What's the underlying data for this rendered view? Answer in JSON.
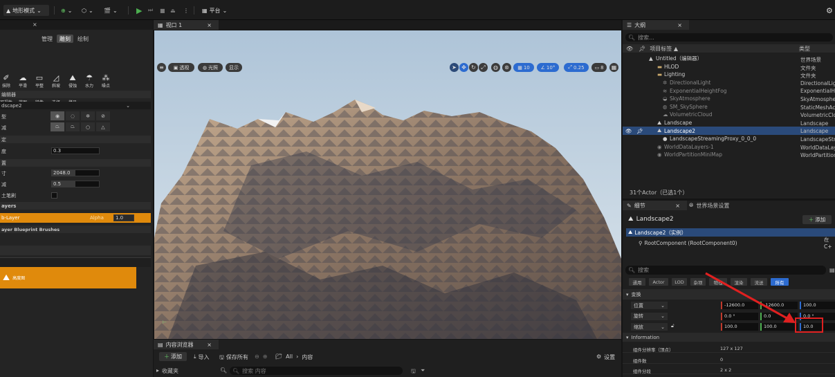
{
  "topbar": {
    "mode_label": "地形模式",
    "platform_label": "平台"
  },
  "left_panel": {
    "tab_close": "×",
    "subtabs": [
      "管理",
      "雕刻",
      "绘制"
    ],
    "active_subtab": 1,
    "tools_row1": [
      {
        "label": "抹除",
        "icon": "erase-icon"
      },
      {
        "label": "平滑",
        "icon": "smooth-icon"
      },
      {
        "label": "平整",
        "icon": "flatten-icon"
      },
      {
        "label": "斜坡",
        "icon": "ramp-icon"
      },
      {
        "label": "侵蚀",
        "icon": "erosion-icon"
      },
      {
        "label": "水力",
        "icon": "hydro-icon"
      },
      {
        "label": "噪点",
        "icon": "noise-icon"
      }
    ],
    "tools_row2": [
      {
        "label": "可视性",
        "icon": "visibility-icon"
      },
      {
        "label": "蓝图",
        "icon": "blueprint-icon"
      },
      {
        "label": "镜像",
        "icon": "mirror-icon"
      },
      {
        "label": "选择",
        "icon": "select-icon"
      },
      {
        "label": "拷贝",
        "icon": "copy-icon"
      }
    ],
    "section_editor": "编辑器",
    "landscape_select": "dscape2",
    "brush_type_label": "型",
    "falloff_label": "减",
    "section_settings": "定",
    "strength_label": "度",
    "strength_value": "0.3",
    "section_brush": "置",
    "size_label": "寸",
    "size_value": "2048.0",
    "falloff_value_label": "减",
    "falloff_value": "0.5",
    "terrain_brush_label": "土笔刷",
    "section_layers": "ayers",
    "layer_name": "b-Layer",
    "layer_alpha_label": "Alpha",
    "layer_alpha_value": "1.0",
    "section_bp_brushes": "ayer Blueprint Brushes",
    "thumb_label": "高度图"
  },
  "viewport": {
    "tab_label": "视口 1",
    "tab_close": "×",
    "btn_perspective": "透视",
    "btn_lit": "光照",
    "btn_show": "显示",
    "grid_value": "10",
    "angle_value": "10°",
    "scale_value": "0.25",
    "camera_value": "8"
  },
  "outliner": {
    "tab_label": "大纲",
    "tab_close": "×",
    "search_placeholder": "搜索...",
    "col_label": "项目标签 ▲",
    "col_type": "类型",
    "rows": [
      {
        "label": "Untitled（编辑器）",
        "type": "世界场景",
        "indent": 38,
        "icon": "world-icon",
        "dim": false
      },
      {
        "label": "HLOD",
        "type": "文件夹",
        "indent": 50,
        "icon": "folder-icon",
        "dim": false
      },
      {
        "label": "Lighting",
        "type": "文件夹",
        "indent": 50,
        "icon": "folder-icon",
        "dim": false
      },
      {
        "label": "DirectionalLight",
        "type": "DirectionalLigh",
        "indent": 58,
        "icon": "light-icon",
        "dim": true
      },
      {
        "label": "ExponentialHeightFog",
        "type": "ExponentialHe",
        "indent": 58,
        "icon": "fog-icon",
        "dim": true
      },
      {
        "label": "SkyAtmosphere",
        "type": "SkyAtmosphere",
        "indent": 58,
        "icon": "sky-icon",
        "dim": true
      },
      {
        "label": "SM_SkySphere",
        "type": "StaticMeshAct",
        "indent": 58,
        "icon": "mesh-icon",
        "dim": true
      },
      {
        "label": "VolumetricCloud",
        "type": "VolumetricClou",
        "indent": 58,
        "icon": "cloud-icon",
        "dim": true
      },
      {
        "label": "Landscape",
        "type": "Landscape",
        "indent": 50,
        "icon": "landscape-icon",
        "dim": false
      },
      {
        "label": "Landscape2",
        "type": "Landscape",
        "indent": 50,
        "icon": "landscape-icon",
        "dim": false
      },
      {
        "label": "LandscapeStreamingProxy_0_0_0",
        "type": "LandscapeStre",
        "indent": 58,
        "icon": "proxy-icon",
        "dim": false
      },
      {
        "label": "WorldDataLayers-1",
        "type": "WorldDataLay",
        "indent": 50,
        "icon": "data-icon",
        "dim": true
      },
      {
        "label": "WorldPartitionMiniMap",
        "type": "WorldPartition",
        "indent": 50,
        "icon": "map-icon",
        "dim": true
      }
    ],
    "selected_row": 9,
    "status": "31个Actor（已选1个）"
  },
  "details": {
    "tab_label": "细节",
    "tab_close": "×",
    "world_settings_tab": "世界场景设置",
    "actor_name": "Landscape2",
    "add_button": "添加",
    "instance_label": "Landscape2（实例）",
    "root_component": "RootComponent (RootComponent0)",
    "root_edit": "在C+",
    "search_placeholder": "搜索",
    "filter_chips": [
      "通用",
      "Actor",
      "LOD",
      "杂项",
      "物理",
      "渲染",
      "流送",
      "所有"
    ],
    "active_chip": 7,
    "section_transform": "变换",
    "location_label": "位置",
    "rotation_label": "旋转",
    "scale_label": "缩放",
    "location": [
      "-12600.0",
      "-12600.0",
      "100.0"
    ],
    "rotation": [
      "0.0 °",
      "0.0",
      "0.0 °"
    ],
    "scale": [
      "100.0",
      "100.0",
      "10.0"
    ],
    "section_info": "Information",
    "info": [
      {
        "label": "组件分辨率（顶点）",
        "value": "127 x 127"
      },
      {
        "label": "组件数",
        "value": "0"
      },
      {
        "label": "组件分段",
        "value": "2 x 2"
      }
    ]
  },
  "content_browser": {
    "tab_label": "内容浏览器",
    "tab_close": "×",
    "add_label": "添加",
    "import_label": "导入",
    "save_all_label": "保存所有",
    "path_all": "All",
    "path_content": "内容",
    "settings_label": "设置",
    "favorites_label": "收藏夹",
    "search_placeholder": "搜索 内容"
  },
  "colors": {
    "accent_orange": "#e08a0c",
    "selection_blue": "#2a4a7a",
    "annotation_red": "#e02020"
  }
}
